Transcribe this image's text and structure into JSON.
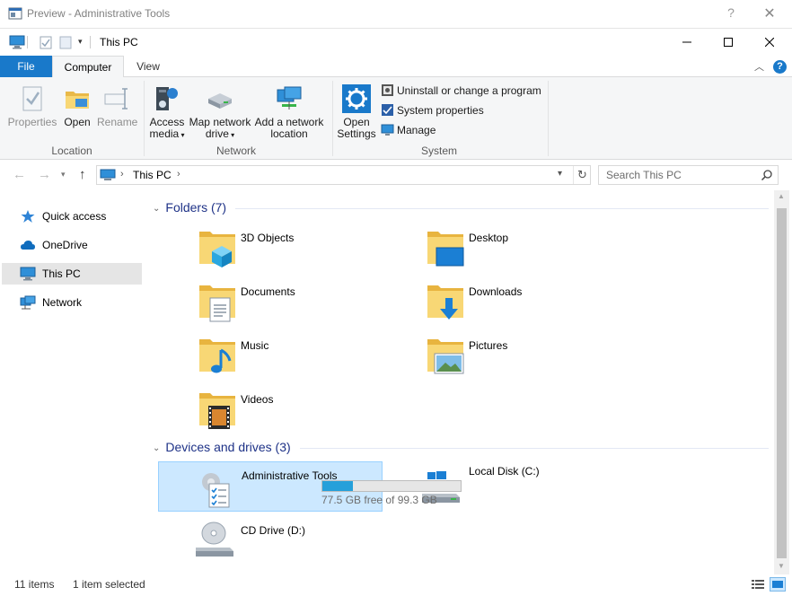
{
  "preview_window": {
    "title": "Preview - Administrative Tools",
    "help_label": "?",
    "close_label": "✕"
  },
  "window": {
    "title": "This PC",
    "minimize_label": "—",
    "maximize_label": "☐",
    "close_label": "✕"
  },
  "ribbon_tabs": [
    {
      "label": "File"
    },
    {
      "label": "Computer"
    },
    {
      "label": "View"
    }
  ],
  "ribbon": {
    "groups": {
      "location": {
        "label": "Location",
        "buttons": [
          {
            "label": "Properties",
            "icon": "properties-icon",
            "enabled": false
          },
          {
            "label": "Open",
            "icon": "folder-open-icon",
            "enabled": true
          },
          {
            "label": "Rename",
            "icon": "rename-icon",
            "enabled": false
          }
        ]
      },
      "network": {
        "label": "Network",
        "buttons": [
          {
            "label_line1": "Access",
            "label_line2": "media",
            "icon": "access-media-icon"
          },
          {
            "label_line1": "Map network",
            "label_line2": "drive",
            "icon": "map-drive-icon"
          },
          {
            "label_line1": "Add a network",
            "label_line2": "location",
            "icon": "network-location-icon"
          }
        ]
      },
      "system": {
        "label": "System",
        "open_settings_line1": "Open",
        "open_settings_line2": "Settings",
        "items": [
          {
            "label": "Uninstall or change a program",
            "icon": "uninstall-icon"
          },
          {
            "label": "System properties",
            "icon": "system-properties-icon"
          },
          {
            "label": "Manage",
            "icon": "manage-icon"
          }
        ]
      }
    }
  },
  "address_bar": {
    "breadcrumb": "This PC",
    "separator": "›",
    "search_placeholder": "Search This PC"
  },
  "nav_pane": {
    "items": [
      {
        "label": "Quick access",
        "icon": "star-icon",
        "selected": false
      },
      {
        "label": "OneDrive",
        "icon": "cloud-icon",
        "selected": false
      },
      {
        "label": "This PC",
        "icon": "computer-icon",
        "selected": true
      },
      {
        "label": "Network",
        "icon": "network-icon",
        "selected": false
      }
    ]
  },
  "folders": {
    "heading": "Folders (7)",
    "items": [
      {
        "name": "3D Objects",
        "icon": "3d-objects-folder-icon"
      },
      {
        "name": "Desktop",
        "icon": "desktop-folder-icon"
      },
      {
        "name": "Documents",
        "icon": "documents-folder-icon"
      },
      {
        "name": "Downloads",
        "icon": "downloads-folder-icon"
      },
      {
        "name": "Music",
        "icon": "music-folder-icon"
      },
      {
        "name": "Pictures",
        "icon": "pictures-folder-icon"
      },
      {
        "name": "Videos",
        "icon": "videos-folder-icon"
      }
    ]
  },
  "devices": {
    "heading": "Devices and drives (3)",
    "items": [
      {
        "name": "Administrative Tools",
        "icon": "admin-tools-icon",
        "selected": true
      },
      {
        "name": "Local Disk (C:)",
        "icon": "local-disk-icon",
        "free_text": "77.5 GB free of 99.3 GB",
        "used_fraction": 0.22
      },
      {
        "name": "CD Drive (D:)",
        "icon": "cd-drive-icon"
      }
    ]
  },
  "status_bar": {
    "item_count": "11 items",
    "selection": "1 item selected"
  },
  "colors": {
    "accent": "#1979ca",
    "selection_bg": "#cce8ff",
    "group_heading": "#1e3287",
    "drive_fill": "#26a0da"
  }
}
